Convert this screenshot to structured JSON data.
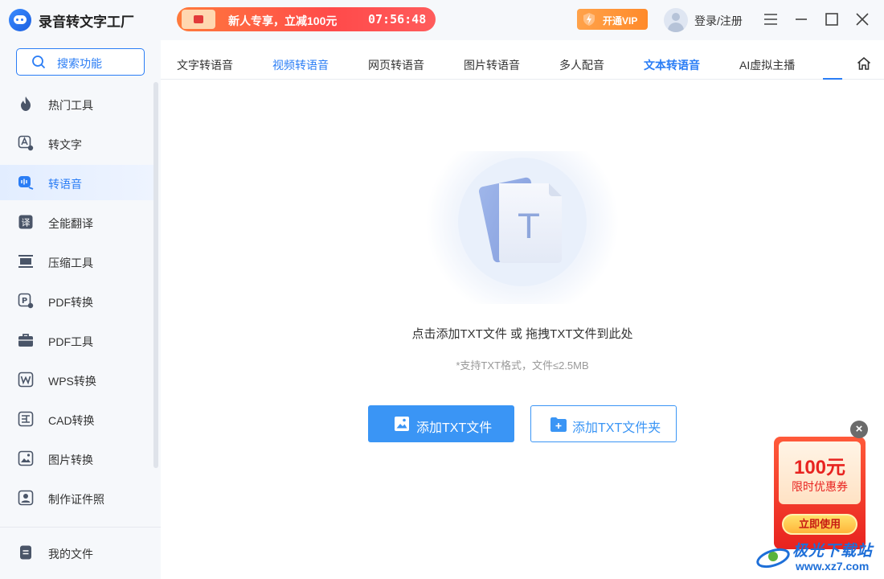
{
  "app": {
    "title": "录音转文字工厂"
  },
  "promo": {
    "text": "新人专享，立减100元",
    "timer": "07:56:48"
  },
  "header": {
    "vip_label": "开通VIP",
    "login_label": "登录/注册"
  },
  "sidebar": {
    "search_label": "搜索功能",
    "items": [
      {
        "label": "热门工具",
        "icon": "flame-icon"
      },
      {
        "label": "转文字",
        "icon": "text-convert-icon"
      },
      {
        "label": "转语音",
        "icon": "voice-icon"
      },
      {
        "label": "全能翻译",
        "icon": "translate-icon"
      },
      {
        "label": "压缩工具",
        "icon": "compress-icon"
      },
      {
        "label": "PDF转换",
        "icon": "pdf-convert-icon"
      },
      {
        "label": "PDF工具",
        "icon": "toolbox-icon"
      },
      {
        "label": "WPS转换",
        "icon": "wps-icon"
      },
      {
        "label": "CAD转换",
        "icon": "cad-icon"
      },
      {
        "label": "图片转换",
        "icon": "image-convert-icon"
      },
      {
        "label": "制作证件照",
        "icon": "id-photo-icon"
      }
    ],
    "active_index": 2,
    "my_files_label": "我的文件"
  },
  "tabs": {
    "items": [
      "文字转语音",
      "视频转语音",
      "网页转语音",
      "图片转语音",
      "多人配音",
      "文本转语音",
      "AI虚拟主播"
    ],
    "active_index": 5
  },
  "main": {
    "illustration_letter": "T",
    "drop_text": "点击添加TXT文件 或 拖拽TXT文件到此处",
    "format_text": "*支持TXT格式，文件≤2.5MB",
    "add_file_label": "添加TXT文件",
    "add_folder_label": "添加TXT文件夹"
  },
  "coupon": {
    "amount": "100元",
    "desc": "限时优惠券",
    "button": "立即使用",
    "close": "×"
  },
  "watermark": {
    "line1": "极光下载站",
    "line2": "www.xz7.com"
  },
  "colors": {
    "accent": "#2a7df5",
    "button": "#3a95f5",
    "promo": "#ff4a4a",
    "vip": "#ff8a2a",
    "coupon": "#e8231f"
  }
}
